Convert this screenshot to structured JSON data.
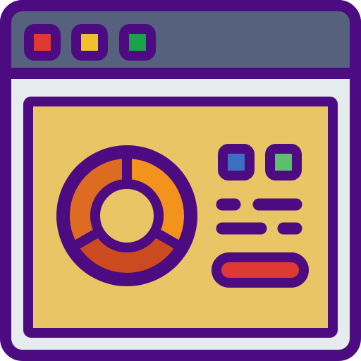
{
  "icon": {
    "name": "browser-dashboard-icon",
    "colors": {
      "outline": "#4d0b82",
      "titlebar": "#56617e",
      "window_body": "#e6ebee",
      "content_panel": "#e9c566",
      "dot_red": "#de3a33",
      "dot_yellow": "#f2c02c",
      "dot_green": "#1aa24a",
      "legend_blue": "#3c6fc4",
      "legend_green": "#5bbf6c",
      "donut_left": "#de6b22",
      "donut_right": "#f3931e",
      "donut_bottom": "#cb4a1f",
      "donut_hole": "#e9c566",
      "action_button": "#de3a33"
    }
  }
}
